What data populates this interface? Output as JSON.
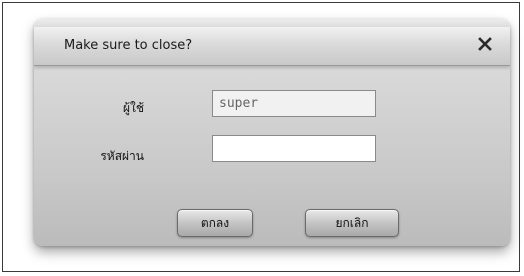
{
  "dialog": {
    "title": "Make sure to close?",
    "close_label": "X"
  },
  "form": {
    "username_label": "ผู้ใช้",
    "username_value": "super",
    "password_label": "รหัสผ่าน",
    "password_value": ""
  },
  "buttons": {
    "ok_label": "ตกลง",
    "cancel_label": "ยกเลิก"
  }
}
